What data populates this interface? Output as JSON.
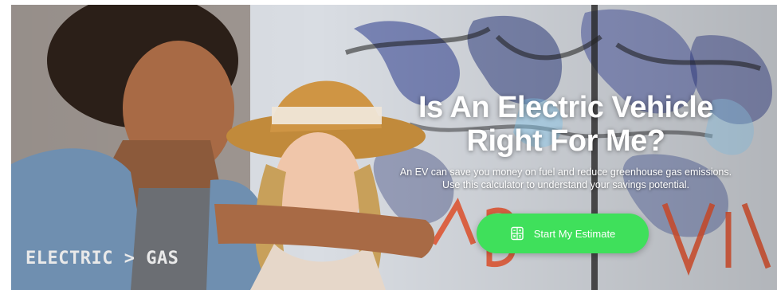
{
  "hero": {
    "headline_line1": "Is An Electric Vehicle",
    "headline_line2": "Right For Me?",
    "subtext_line1": "An EV can save you money on fuel and reduce greenhouse gas emissions.",
    "subtext_line2": "Use this calculator to understand your savings potential.",
    "cta_label": "Start My Estimate",
    "cta_icon": "calculator-icon",
    "shirt_text": "ELECTRIC > GAS"
  },
  "colors": {
    "cta_background": "#3fe05b",
    "text": "#ffffff"
  }
}
